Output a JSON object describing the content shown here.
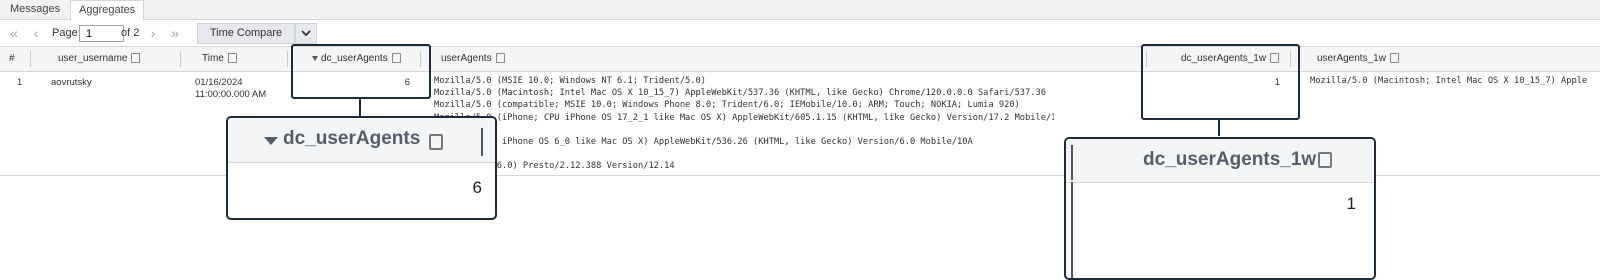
{
  "tabs": [
    {
      "label": "Messages",
      "active": false
    },
    {
      "label": "Aggregates",
      "active": true
    }
  ],
  "pager": {
    "page_label": "Page:",
    "page_value": "1",
    "of_label": "of 2",
    "time_compare_label": "Time Compare"
  },
  "table": {
    "columns": {
      "index": "#",
      "user_username": "user_username",
      "time": "Time",
      "dc_userAgents": "dc_userAgents",
      "userAgents": "userAgents",
      "dc_userAgents_1w": "dc_userAgents_1w",
      "userAgents_1w": "userAgents_1w"
    },
    "rows": [
      {
        "index": "1",
        "user_username": "aovrutsky",
        "time_date": "01/16/2024",
        "time_clock": "11:00:00.000 AM",
        "dc_userAgents": "6",
        "userAgents": "Mozilla/5.0 (MSIE 10.0; Windows NT 6.1; Trident/5.0)\nMozilla/5.0 (Macintosh; Intel Mac OS X 10_15_7) AppleWebKit/537.36 (KHTML, like Gecko) Chrome/120.0.0.0 Safari/537.36\nMozilla/5.0 (compatible; MSIE 10.0; Windows Phone 8.0; Trident/6.0; IEMobile/10.0; ARM; Touch; NOKIA; Lumia 920)\nMozilla/5.0 (iPhone; CPU iPhone OS 17_2_1 like Mac OS X) AppleWebKit/605.1.15 (KHTML, like Gecko) Version/17.2 Mobile/15E148\n)\n(iPhone; CPU iPhone OS 6_0 like Mac OS X) AppleWebKit/536.26 (KHTML, like Gecko) Version/6.0 Mobile/10A\n.25\n(Windows NT 6.0) Presto/2.12.388 Version/12.14",
        "dc_userAgents_1w": "1",
        "userAgents_1w": "Mozilla/5.0 (Macintosh; Intel Mac OS X 10_15_7) Apple"
      }
    ]
  },
  "zoom_callouts": [
    {
      "header": "dc_userAgents",
      "value": "6"
    },
    {
      "header": "dc_userAgents_1w",
      "value": "1"
    }
  ],
  "colors": {
    "callout_border": "#1c2b3a",
    "header_bg": "#f3f5f7",
    "button_bg": "#e6e8eb"
  }
}
